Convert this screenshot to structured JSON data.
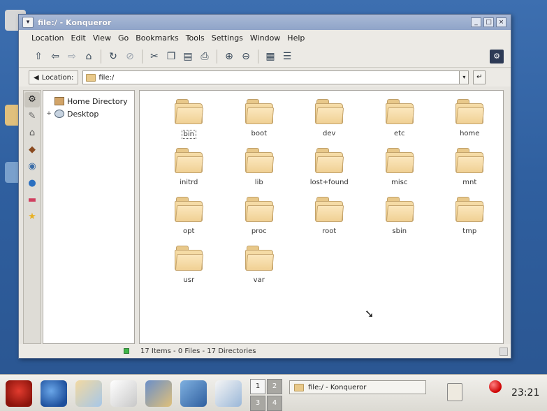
{
  "window": {
    "title": "file:/ - Konqueror",
    "minimize_label": "_",
    "maximize_label": "□",
    "close_label": "×"
  },
  "menubar": [
    "Location",
    "Edit",
    "View",
    "Go",
    "Bookmarks",
    "Tools",
    "Settings",
    "Window",
    "Help"
  ],
  "toolbar": {
    "icons": [
      "up-arrow-icon",
      "back-arrow-icon",
      "forward-arrow-icon",
      "home-icon",
      "reload-icon",
      "stop-icon",
      "cut-icon",
      "copy-icon",
      "paste-icon",
      "print-icon",
      "zoom-in-icon",
      "zoom-out-icon",
      "icon-view-icon",
      "detail-view-icon"
    ]
  },
  "location": {
    "button_label": "Location:",
    "value": "file:/"
  },
  "tree": {
    "items": [
      "Home Directory",
      "Desktop"
    ]
  },
  "folders": [
    {
      "name": "bin",
      "selected": true
    },
    {
      "name": "boot"
    },
    {
      "name": "dev"
    },
    {
      "name": "etc"
    },
    {
      "name": "home"
    },
    {
      "name": "initrd"
    },
    {
      "name": "lib"
    },
    {
      "name": "lost+found"
    },
    {
      "name": "misc"
    },
    {
      "name": "mnt"
    },
    {
      "name": "opt"
    },
    {
      "name": "proc"
    },
    {
      "name": "root"
    },
    {
      "name": "sbin"
    },
    {
      "name": "tmp"
    },
    {
      "name": "usr"
    },
    {
      "name": "var"
    }
  ],
  "status": {
    "text": "17 Items - 0 Files - 17 Directories"
  },
  "taskbar": {
    "pager": [
      "1",
      "2",
      "3",
      "4"
    ],
    "task_label": "file:/ - Konqueror",
    "clock": "23:21"
  }
}
